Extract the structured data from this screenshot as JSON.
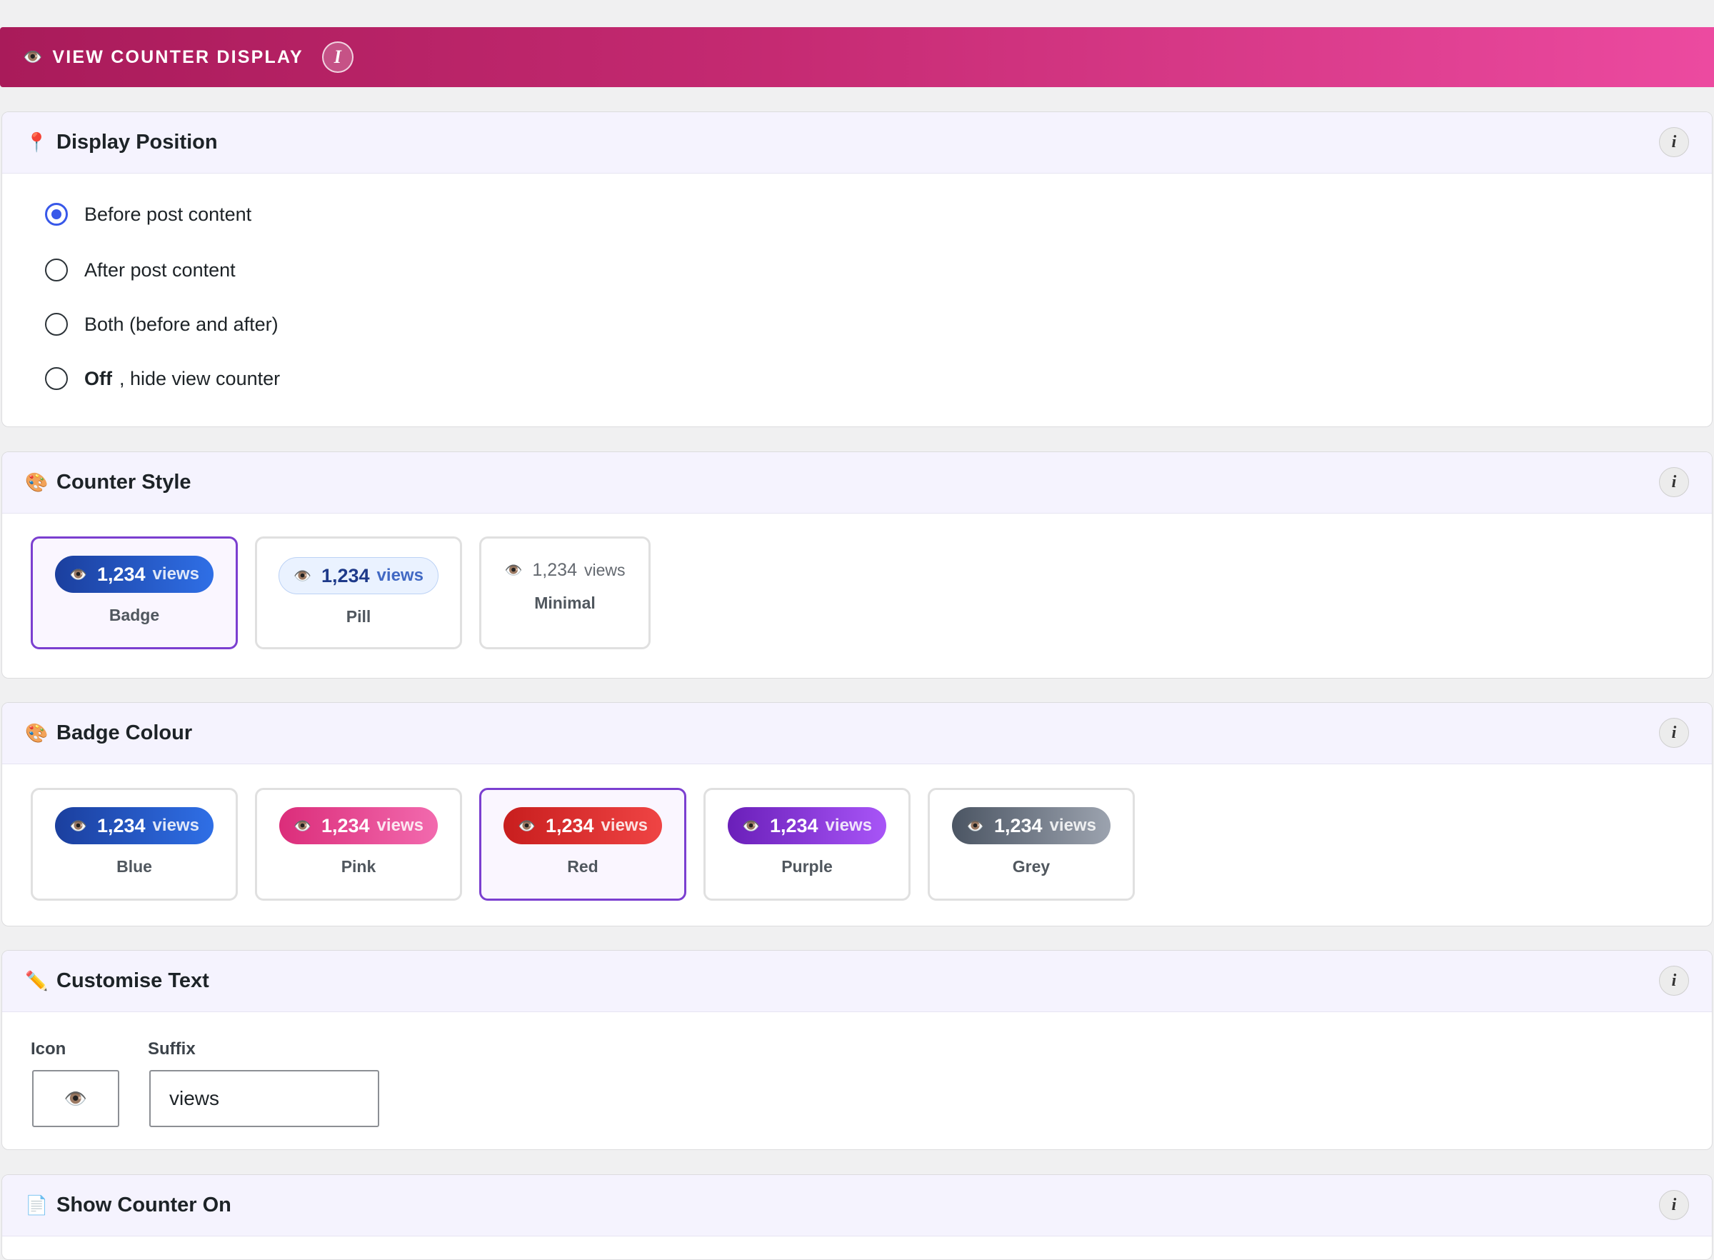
{
  "banner": {
    "icon": "eye-icon",
    "title": "VIEW COUNTER DISPLAY",
    "info_glyph": "I"
  },
  "display_position": {
    "icon": "pushpin-icon",
    "title": "Display Position",
    "info_glyph": "i",
    "options": [
      {
        "label": "Before post content",
        "checked": true
      },
      {
        "label": "After post content",
        "checked": false
      },
      {
        "label": "Both (before and after)",
        "checked": false
      },
      {
        "bold": "Off",
        "label": ", hide view counter",
        "checked": false
      }
    ]
  },
  "counter_style": {
    "icon": "palette-icon",
    "title": "Counter Style",
    "info_glyph": "i",
    "selected": "Badge",
    "options": [
      {
        "name": "Badge",
        "count": "1,234",
        "suffix": "views"
      },
      {
        "name": "Pill",
        "count": "1,234",
        "suffix": "views"
      },
      {
        "name": "Minimal",
        "count": "1,234",
        "suffix": "views"
      }
    ]
  },
  "badge_colour": {
    "icon": "palette-icon",
    "title": "Badge Colour",
    "info_glyph": "i",
    "selected": "Red",
    "options": [
      {
        "name": "Blue",
        "count": "1,234",
        "suffix": "views",
        "color": "#1b3f9e"
      },
      {
        "name": "Pink",
        "count": "1,234",
        "suffix": "views",
        "color": "#db2d7a"
      },
      {
        "name": "Red",
        "count": "1,234",
        "suffix": "views",
        "color": "#c81e1e"
      },
      {
        "name": "Purple",
        "count": "1,234",
        "suffix": "views",
        "color": "#6a1fb9"
      },
      {
        "name": "Grey",
        "count": "1,234",
        "suffix": "views",
        "color": "#4b5563"
      }
    ]
  },
  "customise_text": {
    "icon": "pencil-icon",
    "title": "Customise Text",
    "info_glyph": "i",
    "icon_label": "Icon",
    "icon_value": "👁️",
    "suffix_label": "Suffix",
    "suffix_value": "views"
  },
  "show_counter_on": {
    "icon": "document-icon",
    "title": "Show Counter On",
    "info_glyph": "i"
  },
  "glyphs": {
    "eye": "👁️",
    "pin": "📍",
    "palette": "🎨",
    "pencil": "✏️",
    "page": "📄"
  },
  "colors": {
    "accent": "#3858e9",
    "selected_border": "#7b3fd0"
  }
}
